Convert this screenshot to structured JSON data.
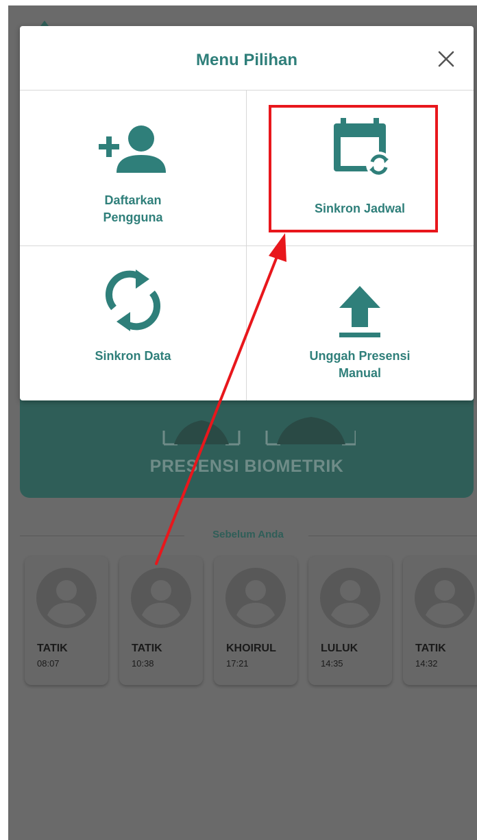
{
  "modal": {
    "title": "Menu Pilihan",
    "close_icon": "close-icon",
    "items": [
      {
        "label_lines": [
          "Daftarkan",
          "Pengguna"
        ],
        "icon": "add-user-icon"
      },
      {
        "label_lines": [
          "Sinkron Jadwal"
        ],
        "icon": "calendar-sync-icon",
        "highlighted": true
      },
      {
        "label_lines": [
          "Sinkron Data"
        ],
        "icon": "sync-icon"
      },
      {
        "label_lines": [
          "Unggah Presensi",
          "Manual"
        ],
        "icon": "upload-icon"
      }
    ]
  },
  "background": {
    "biometric_title": "PRESENSI BIOMETRIK",
    "recent_label": "Sebelum Anda",
    "recent_users": [
      {
        "name": "TATIK",
        "time": "08:07"
      },
      {
        "name": "TATIK",
        "time": "10:38"
      },
      {
        "name": "KHOIRUL",
        "time": "17:21"
      },
      {
        "name": "LULUK",
        "time": "14:35"
      },
      {
        "name": "TATIK",
        "time": "14:32"
      }
    ]
  },
  "colors": {
    "accent": "#2f7f7a",
    "overlay": "#6a6a6a",
    "highlight": "#e8171c",
    "biometric_card": "#2f5e58"
  }
}
